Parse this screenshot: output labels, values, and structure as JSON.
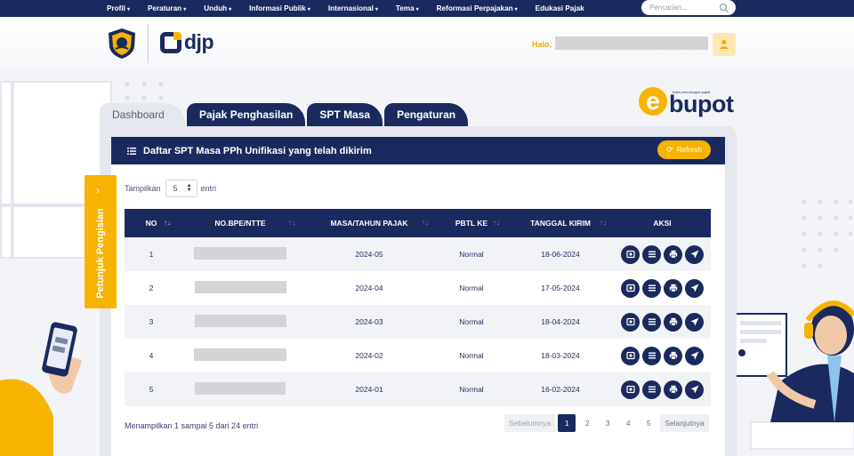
{
  "nav": {
    "items": [
      {
        "label": "Profil",
        "caret": "▾"
      },
      {
        "label": "Peraturan",
        "caret": "▾"
      },
      {
        "label": "Unduh",
        "caret": "▾"
      },
      {
        "label": "Informasi Publik",
        "caret": "▾"
      },
      {
        "label": "Internasional",
        "caret": "▾"
      },
      {
        "label": "Tema",
        "caret": "▾"
      },
      {
        "label": "Reformasi Perpajakan",
        "caret": "▾"
      },
      {
        "label": "Edukasi Pajak",
        "caret": ""
      }
    ],
    "search_placeholder": "Pencarian..."
  },
  "header": {
    "brand": "djp",
    "greeting": "Halo,"
  },
  "ebupot": {
    "name": "bupot",
    "letter": "e",
    "tagline": "bukti pemotongan pajak"
  },
  "tabs": [
    {
      "label": "Dashboard",
      "active": true
    },
    {
      "label": "Pajak Penghasilan",
      "active": false
    },
    {
      "label": "SPT Masa",
      "active": false
    },
    {
      "label": "Pengaturan",
      "active": false
    }
  ],
  "side_tab": {
    "label": "Petunjuk Pengisian",
    "chevron": "›"
  },
  "panel": {
    "title": "Daftar SPT Masa PPh Unifikasi yang telah dikirim",
    "refresh_label": "Refresh",
    "refresh_icon": "⟳",
    "show_prefix": "Tampilkan",
    "show_value": "5",
    "show_suffix": "entri",
    "columns": [
      "NO",
      "NO.BPE/NTTE",
      "MASA/TAHUN PAJAK",
      "PBTL KE",
      "TANGGAL KIRIM",
      "AKSI"
    ],
    "sort_active": "↑↓",
    "sort_idle": "↑↓",
    "rows": [
      {
        "no": "1",
        "masa": "2024-05",
        "pbtl": "Normal",
        "tanggal": "18-06-2024"
      },
      {
        "no": "2",
        "masa": "2024-04",
        "pbtl": "Normal",
        "tanggal": "17-05-2024"
      },
      {
        "no": "3",
        "masa": "2024-03",
        "pbtl": "Normal",
        "tanggal": "18-04-2024"
      },
      {
        "no": "4",
        "masa": "2024-02",
        "pbtl": "Normal",
        "tanggal": "18-03-2024"
      },
      {
        "no": "5",
        "masa": "2024-01",
        "pbtl": "Normal",
        "tanggal": "16-02-2024"
      }
    ],
    "info": "Menampilkan 1 sampai 5 dari 24 entri",
    "pager": {
      "prev": "Sebelumnya",
      "pages": [
        "1",
        "2",
        "3",
        "4",
        "5"
      ],
      "current": "1",
      "next": "Selanjutnya"
    }
  },
  "icons": {
    "row_actions": [
      "view-icon",
      "list-icon",
      "print-icon",
      "send-icon"
    ]
  },
  "colors": {
    "navy": "#1b2a5e",
    "accent": "#f6b400"
  }
}
